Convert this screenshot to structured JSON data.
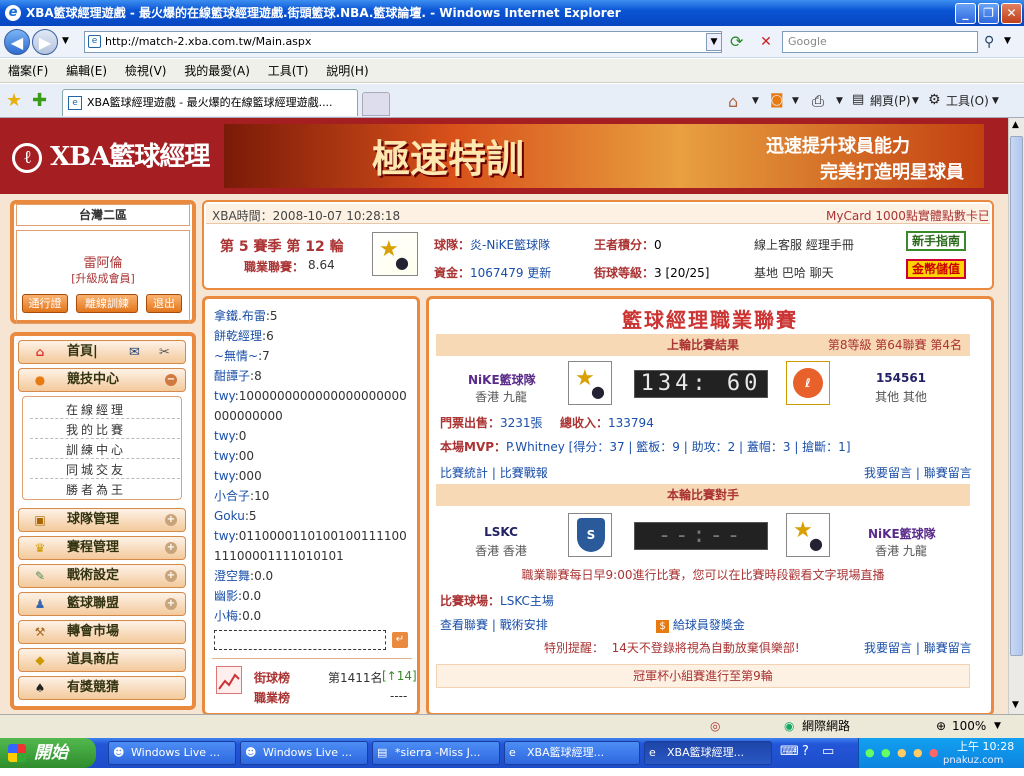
{
  "window": {
    "title": "XBA籃球經理遊戲 - 最火爆的在線籃球經理遊戲.街頭籃球.NBA.籃球論壇. - Windows Internet Explorer"
  },
  "browser": {
    "url": "http://match-2.xba.com.tw/Main.aspx",
    "search_placeholder": "Google",
    "tab_title": "XBA籃球經理遊戲 - 最火爆的在線籃球經理遊戲....",
    "menu": [
      "檔案(F)",
      "編輯(E)",
      "檢視(V)",
      "我的最愛(A)",
      "工具(T)",
      "說明(H)"
    ],
    "page_btn": "網頁(P)",
    "tools_btn": "工具(O)"
  },
  "site": {
    "logo": "XBA籃球經理",
    "banner_big": "極速特訓",
    "banner_line1": "迅速提升球員能力",
    "banner_line2": "完美打造明星球員"
  },
  "user": {
    "region": "台灣二區",
    "name": "雷阿倫",
    "membership": "[升級成會員]",
    "btn_pass": "通行證",
    "btn_train": "離線訓練",
    "btn_logout": "退出"
  },
  "nav": {
    "home": "首頁|",
    "arena": "競技中心",
    "arena_subs": [
      "在線經理",
      "我的比賽",
      "訓練中心",
      "同城交友",
      "勝者為王"
    ],
    "team": "球隊管理",
    "schedule": "賽程管理",
    "tactics": "戰術設定",
    "league": "籃球聯盟",
    "transfer": "轉會市場",
    "shop": "道具商店",
    "lottery": "有獎競猜"
  },
  "info": {
    "time": "XBA時間：2008-10-07 10:28:18",
    "mycard": "MyCard 1000點實體點數卡已經",
    "season": "第 5 賽季 第 12 輪",
    "league_label": "職業聯賽：",
    "league_val": "8.64",
    "team_label": "球隊：",
    "team": "炎-NiKE籃球隊",
    "king_label": "王者積分：",
    "king": "0",
    "service": "線上客服 經理手冊",
    "guide": "新手指南",
    "funds_label": "資金：",
    "funds": "1067479",
    "update": "更新",
    "street_label": "街球等級：",
    "street": "3 [20/25]",
    "links2": "基地 巴哈 聊天",
    "deposit": "金幣儲值"
  },
  "chat": {
    "lines": [
      [
        "拿鐵.布雷",
        "5"
      ],
      [
        "餅乾經理",
        "6"
      ],
      [
        "~無情~",
        "7"
      ],
      [
        "酣譚子",
        "8"
      ],
      [
        "twy",
        "1000000000000000000000000000000"
      ],
      [
        "twy",
        "0"
      ],
      [
        "twy",
        "00"
      ],
      [
        "twy",
        "000"
      ],
      [
        "小合子",
        "10"
      ],
      [
        "Goku",
        "5"
      ],
      [
        "twy",
        "011000011010010011110011100001111010101"
      ],
      [
        "澄空舞",
        "0.0"
      ],
      [
        "幽影",
        "0.0"
      ],
      [
        "小梅",
        "0.0"
      ]
    ],
    "rank_label": "街球榜",
    "rank_val": "第1411名",
    "rank_sub": "[↑14]",
    "rank2_label": "職業榜",
    "rank2_val": "----"
  },
  "league": {
    "title": "籃球經理職業聯賽",
    "last_header": "上輪比賽結果",
    "last_meta": "第8等級 第64聯賽 第4名",
    "home_team": "NiKE籃球隊",
    "home_loc": "香港 九龍",
    "score": "134: 60",
    "away_team": "154561",
    "away_loc": "其他 其他",
    "tickets_label": "門票出售：",
    "tickets": "3231張",
    "income_label": "總收入：",
    "income": "133794",
    "mvp_label": "本場MVP：",
    "mvp": "P.Whitney",
    "mvp_stats": "[得分：37 | 籃板：9 | 助攻：2 | 蓋帽：3 | 搶斷：1]",
    "stats_link": "比賽統計",
    "report_link": "比賽戰報",
    "msg_link": "我要留言",
    "league_msg": "聯賽留言",
    "next_header": "本輪比賽對手",
    "opp_team": "LSKC",
    "opp_loc": "香港 香港",
    "next_score": "--:--",
    "my_team": "NiKE籃球隊",
    "my_loc": "香港 九龍",
    "notice": "職業聯賽每日早9:00進行比賽，您可以在比賽時段觀看文字現場直播",
    "arena_label": "比賽球場：",
    "arena": "LSKC主場",
    "view_link": "查看聯賽",
    "tactic_link": "戰術安排",
    "bonus": "給球員發獎金",
    "tip_label": "特別提醒：",
    "tip": "14天不登錄將視為自動放棄俱樂部!",
    "cup": "冠軍杯小組賽進行至第9輪"
  },
  "status": {
    "zone": "網際網路",
    "zoom": "100%"
  },
  "taskbar": {
    "start": "開始",
    "tasks": [
      "Windows Live ...",
      "Windows Live ...",
      "*sierra -Miss J...",
      "XBA籃球經理...",
      "XBA籃球經理..."
    ],
    "clock": "上午 10:28",
    "watermark": "pnakuz.com"
  }
}
